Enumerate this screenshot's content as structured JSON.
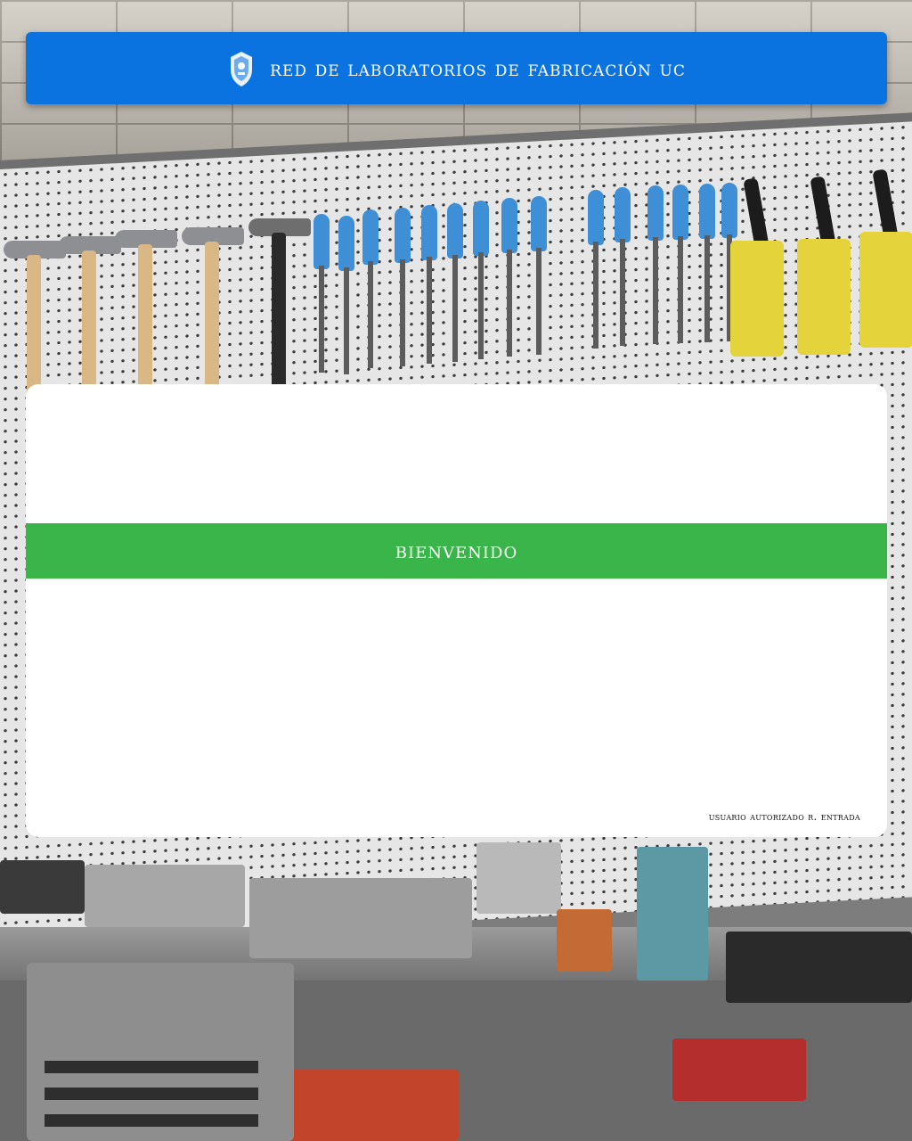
{
  "header": {
    "logo_icon": "university-crest-icon",
    "title": "RED DE LABORATORIOS DE FABRICACIÓN UC"
  },
  "card": {
    "welcome": "BIENVENIDO",
    "status": "USUARIO AUTORIZADO R. ENTRADA"
  },
  "colors": {
    "header_blue": "#0a73df",
    "welcome_green": "#3ab54a",
    "card_white": "#ffffff"
  },
  "background": {
    "icon": "workshop-photo"
  }
}
